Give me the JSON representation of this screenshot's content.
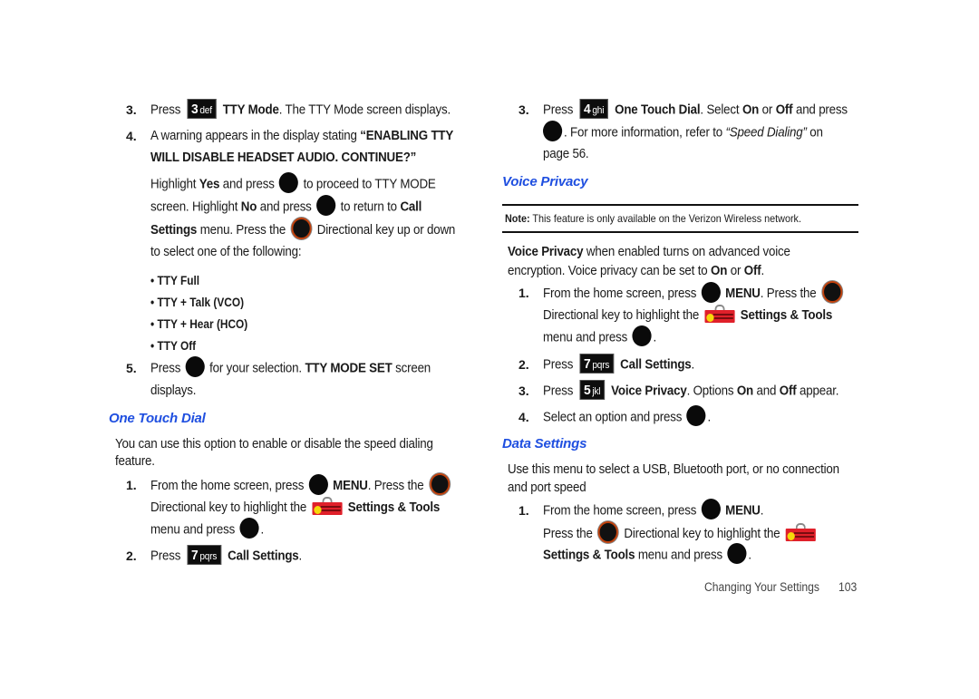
{
  "left_column": {
    "tty_steps": {
      "step3": {
        "num": "3.",
        "press": "Press",
        "key": {
          "digit": "3",
          "letters": "def"
        },
        "bold": "TTY Mode",
        "rest": ". The TTY Mode screen displays."
      },
      "step4": {
        "num": "4.",
        "text": "A warning appears in the display stating",
        "bold_1": "“ENABLING TTY",
        "bold_2": "WILL DISABLE HEADSET AUDIO. CONTINUE?”"
      },
      "step4_detail": {
        "l1_a": "Highlight",
        "l1_yes": "Yes",
        "l1_b": "and press",
        "l1_c": "to proceed to TTY MODE",
        "l2_a": "screen. Highlight",
        "l2_no": "No",
        "l2_b": "and press",
        "l2_c": "to return to",
        "l2_call": "Call",
        "l3_settings": "Settings",
        "l3_a": "menu. Press the",
        "l3_b": "Directional key up or down",
        "l4": "to select one of the following:"
      },
      "options": [
        "TTY Full",
        "TTY + Talk (VCO)",
        "TTY + Hear (HCO)",
        "TTY Off"
      ],
      "step5": {
        "num": "5.",
        "press": "Press",
        "a": "for your selection.",
        "bold": "TTY MODE SET",
        "b": "screen",
        "c": "displays."
      }
    },
    "one_touch_dial": {
      "heading": "One Touch Dial",
      "intro_1": "You can use this option to enable or disable the speed dialing",
      "intro_2": "feature.",
      "step1": {
        "num": "1.",
        "a": "From the home screen, press",
        "menu": "MENU",
        "b": ". Press the",
        "c": "Directional key to highlight the",
        "settings": "Settings & Tools",
        "d": "menu and press",
        "e": "."
      },
      "step2": {
        "num": "2.",
        "press": "Press",
        "key": {
          "digit": "7",
          "letters": "pqrs"
        },
        "bold": "Call Settings",
        "end": "."
      }
    }
  },
  "right_column": {
    "otd_step3": {
      "num": "3.",
      "press": "Press",
      "key": {
        "digit": "4",
        "letters": "ghi"
      },
      "bold": "One Touch Dial",
      "a": ". Select",
      "on": "On",
      "or": "or",
      "off": "Off",
      "b": "and press",
      "c": ". For more information, refer to",
      "ref": "“Speed Dialing”",
      "d": "on",
      "e": "page 56."
    },
    "voice_privacy": {
      "heading": "Voice Privacy",
      "note_label": "Note:",
      "note_text": "This feature is only available on the Verizon Wireless network.",
      "intro_bold": "Voice Privacy",
      "intro_1": "when enabled turns on advanced voice",
      "intro_2a": "encryption. Voice privacy can be set to",
      "intro_on": "On",
      "intro_or": "or",
      "intro_off": "Off",
      "intro_end": ".",
      "step1": {
        "num": "1.",
        "a": "From the home screen, press",
        "menu": "MENU",
        "b": ". Press the",
        "c": "Directional key to highlight the",
        "settings": "Settings & Tools",
        "d": "menu and press",
        "e": "."
      },
      "step2": {
        "num": "2.",
        "press": "Press",
        "key": {
          "digit": "7",
          "letters": "pqrs"
        },
        "bold": "Call Settings",
        "end": "."
      },
      "step3": {
        "num": "3.",
        "press": "Press",
        "key": {
          "digit": "5",
          "letters": "jkl"
        },
        "bold": "Voice Privacy",
        "a": ". Options",
        "on": "On",
        "and": "and",
        "off": "Off",
        "b": "appear."
      },
      "step4": {
        "num": "4.",
        "a": "Select an option and press",
        "end": "."
      }
    },
    "data_settings": {
      "heading": "Data Settings",
      "intro_1": "Use this menu to select a USB, Bluetooth port, or no connection",
      "intro_2": "and port speed",
      "step1": {
        "num": "1.",
        "a": "From the home screen, press",
        "menu": "MENU",
        "end": ".",
        "b": "Press the",
        "c": "Directional key to highlight the",
        "settings": "Settings & Tools",
        "d": "menu and press",
        "e": "."
      }
    }
  },
  "footer": {
    "section": "Changing Your Settings",
    "page": "103"
  },
  "colors": {
    "heading": "#1f4fe0",
    "key_bg": "#0d0d0d",
    "dpad_ring": "#c2410c",
    "toolbox": "#e0202a"
  }
}
